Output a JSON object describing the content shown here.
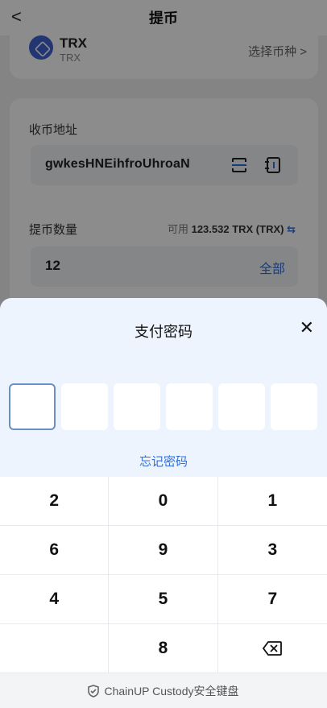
{
  "header": {
    "back_glyph": "<",
    "title": "提币"
  },
  "coin": {
    "name": "TRX",
    "sub": "TRX",
    "select_label": "选择币种 >",
    "icon": "tron-icon"
  },
  "address": {
    "label": "收币地址",
    "value": "gwkesHNEihfroUhroaN",
    "scan_icon": "scan-icon",
    "book_icon": "address-book-icon"
  },
  "amount": {
    "label": "提币数量",
    "available_prefix": "可用",
    "available_value": "123.532 TRX (TRX)",
    "swap_glyph": "⇆",
    "value": "12",
    "all_label": "全部"
  },
  "sheet": {
    "title": "支付密码",
    "close_glyph": "✕",
    "forgot_label": "忘记密码",
    "keys": [
      "2",
      "0",
      "1",
      "6",
      "9",
      "3",
      "4",
      "5",
      "7",
      "",
      "8",
      "⌫"
    ],
    "footer_label": "ChainUP Custody安全键盘"
  },
  "colors": {
    "accent": "#2f6fdc",
    "sheet_bg": "#eef4fd",
    "coin": "#3e63d1"
  }
}
